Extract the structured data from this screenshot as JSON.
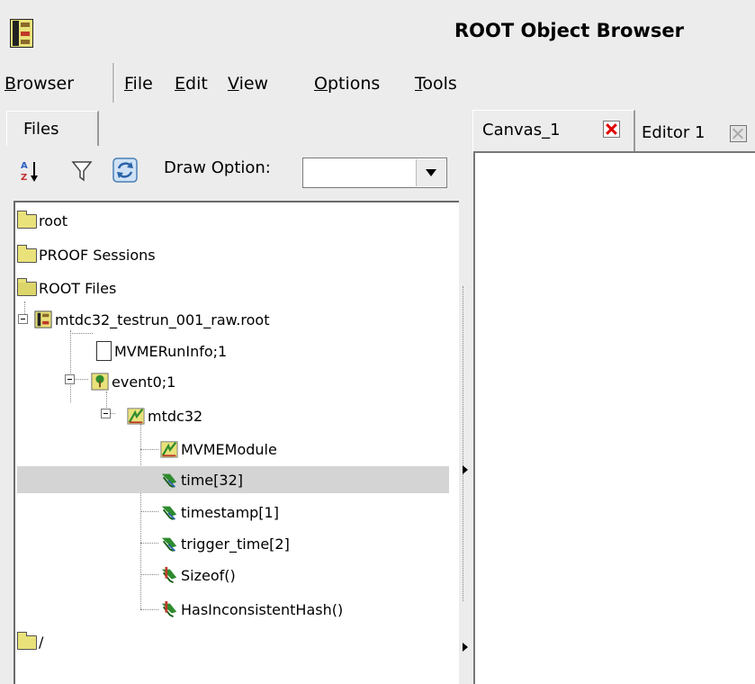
{
  "window": {
    "title": "ROOT Object Browser"
  },
  "menubar": {
    "items": [
      {
        "label": "Browser"
      },
      {
        "label": "File"
      },
      {
        "label": "Edit"
      },
      {
        "label": "View"
      },
      {
        "label": "Options"
      },
      {
        "label": "Tools"
      }
    ]
  },
  "left_panel": {
    "tab_label": "Files",
    "toolbar": {
      "sort_icon": "sort-az-icon",
      "filter_icon": "filter-icon",
      "refresh_icon": "refresh-icon",
      "draw_option_label": "Draw Option:",
      "draw_option_value": ""
    },
    "tree": [
      {
        "label": "root",
        "icon": "folder-icon"
      },
      {
        "label": "PROOF Sessions",
        "icon": "folder-icon"
      },
      {
        "label": "ROOT Files",
        "icon": "folder-open-icon"
      },
      {
        "label": "mtdc32_testrun_001_raw.root",
        "icon": "root-file-icon"
      },
      {
        "label": "MVMERunInfo;1",
        "icon": "document-icon"
      },
      {
        "label": "event0;1",
        "icon": "tree-icon"
      },
      {
        "label": "mtdc32",
        "icon": "branch-element-icon"
      },
      {
        "label": "MVMEModule",
        "icon": "branch-element-icon"
      },
      {
        "label": "time[32]",
        "icon": "leaf-icon",
        "selected": true
      },
      {
        "label": "timestamp[1]",
        "icon": "leaf-icon"
      },
      {
        "label": "trigger_time[2]",
        "icon": "leaf-icon"
      },
      {
        "label": "Sizeof()",
        "icon": "leaf-method-icon"
      },
      {
        "label": "HasInconsistentHash()",
        "icon": "leaf-method-icon"
      },
      {
        "label": "/",
        "icon": "folder-icon"
      }
    ]
  },
  "right_panel": {
    "tabs": [
      {
        "label": "Canvas_1",
        "close_icon": "close-red-icon",
        "active": true
      },
      {
        "label": "Editor 1",
        "close_icon": "close-gray-icon",
        "active": false
      }
    ]
  },
  "colors": {
    "selection": "#d4d4d4",
    "folder": "#e9e27a",
    "close_red": "#e00000",
    "background": "#ececec"
  }
}
